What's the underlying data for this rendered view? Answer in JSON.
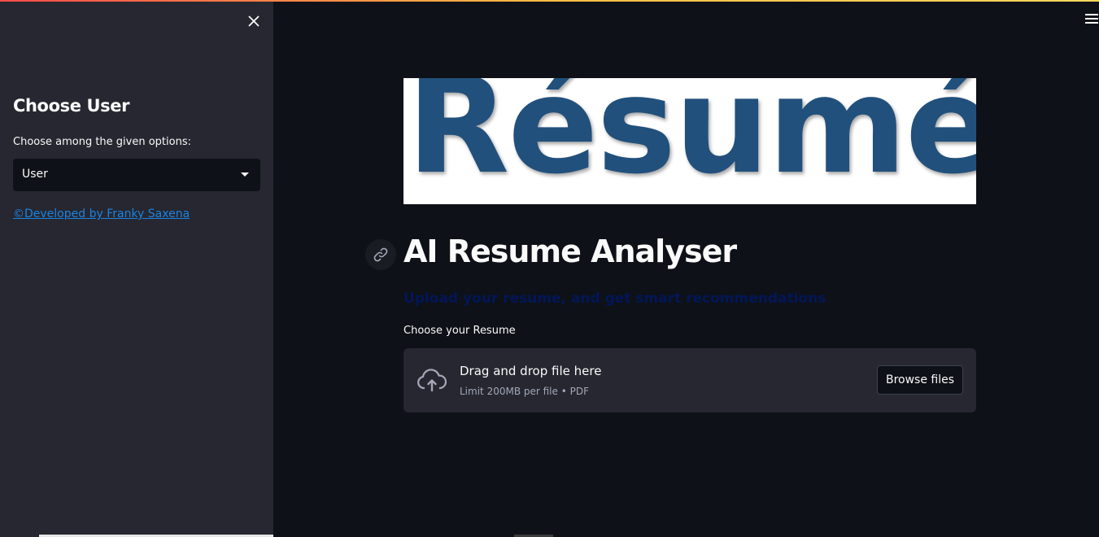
{
  "sidebar": {
    "close_icon": "close-icon",
    "title": "Choose User",
    "select_label": "Choose among the given options:",
    "select_value": "User",
    "developer_link": "©Developed by Franky Saxena"
  },
  "main": {
    "banner_text": "Résumé",
    "title": "AI Resume Analyser",
    "subtitle": "Upload your resume, and get smart recommendations",
    "uploader_label": "Choose your Resume",
    "dropzone_title": "Drag and drop file here",
    "dropzone_limit": "Limit 200MB per file • PDF",
    "browse_label": "Browse files"
  },
  "colors": {
    "background": "#0e1117",
    "sidebar": "#262730",
    "link": "#1c83e1",
    "banner_text": "#21507c",
    "subtitle": "#021659"
  }
}
